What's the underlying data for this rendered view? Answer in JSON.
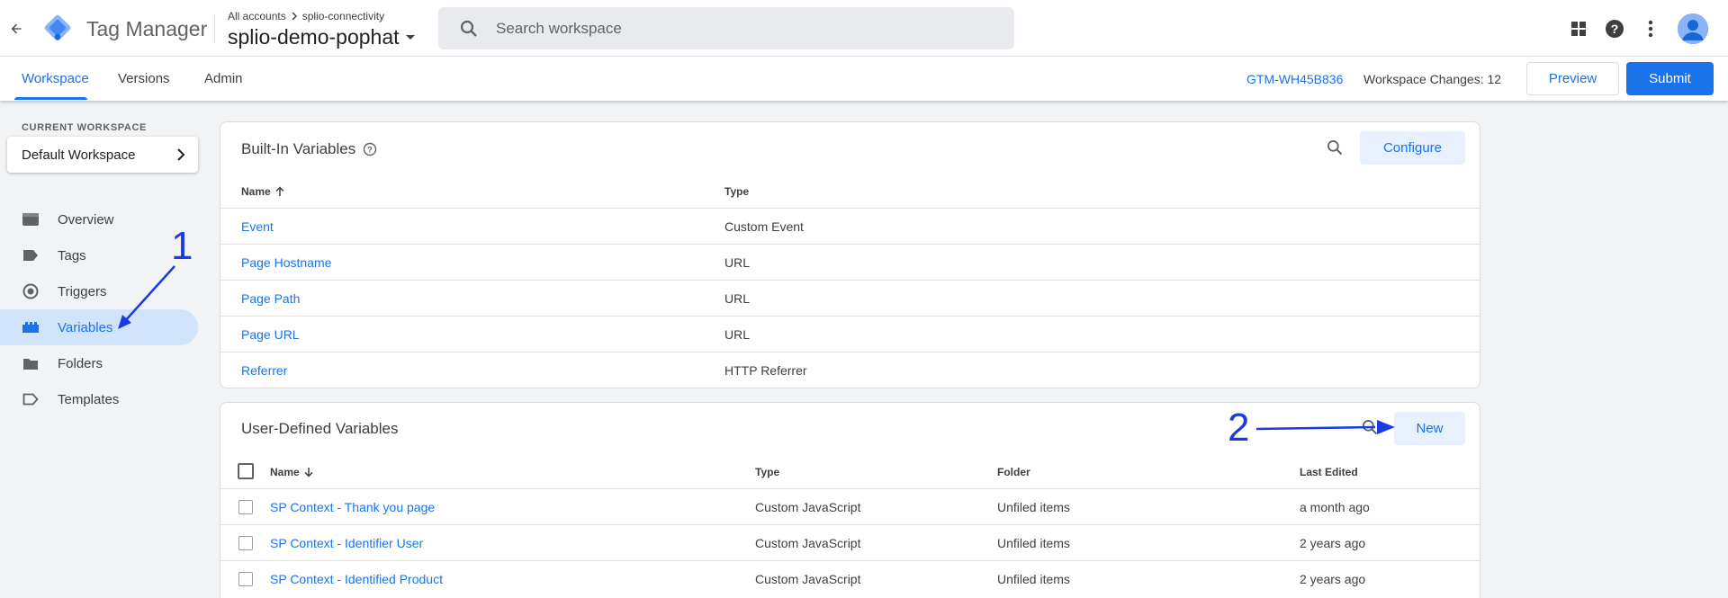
{
  "header": {
    "brand": "Tag Manager",
    "breadcrumb_account": "All accounts",
    "breadcrumb_container": "splio-connectivity",
    "container_name": "splio-demo-pophat",
    "search_placeholder": "Search workspace"
  },
  "subnav": {
    "tabs": [
      {
        "label": "Workspace",
        "active": true
      },
      {
        "label": "Versions",
        "active": false
      },
      {
        "label": "Admin",
        "active": false
      }
    ],
    "container_id": "GTM-WH45B836",
    "workspace_changes": "Workspace Changes: 12",
    "preview_label": "Preview",
    "submit_label": "Submit"
  },
  "sidebar": {
    "current_workspace_label": "CURRENT WORKSPACE",
    "workspace_name": "Default Workspace",
    "items": [
      {
        "label": "Overview",
        "icon": "overview-icon",
        "active": false
      },
      {
        "label": "Tags",
        "icon": "tag-icon",
        "active": false
      },
      {
        "label": "Triggers",
        "icon": "trigger-icon",
        "active": false
      },
      {
        "label": "Variables",
        "icon": "variables-icon",
        "active": true
      },
      {
        "label": "Folders",
        "icon": "folder-icon",
        "active": false
      },
      {
        "label": "Templates",
        "icon": "template-icon",
        "active": false
      }
    ]
  },
  "builtin": {
    "title": "Built-In Variables",
    "configure_label": "Configure",
    "col_name": "Name",
    "col_type": "Type",
    "rows": [
      {
        "name": "Event",
        "type": "Custom Event"
      },
      {
        "name": "Page Hostname",
        "type": "URL"
      },
      {
        "name": "Page Path",
        "type": "URL"
      },
      {
        "name": "Page URL",
        "type": "URL"
      },
      {
        "name": "Referrer",
        "type": "HTTP Referrer"
      }
    ]
  },
  "userdefined": {
    "title": "User-Defined Variables",
    "new_label": "New",
    "col_name": "Name",
    "col_type": "Type",
    "col_folder": "Folder",
    "col_last_edited": "Last Edited",
    "rows": [
      {
        "name": "SP Context - Thank you page",
        "type": "Custom JavaScript",
        "folder": "Unfiled items",
        "last_edited": "a month ago"
      },
      {
        "name": "SP Context - Identifier User",
        "type": "Custom JavaScript",
        "folder": "Unfiled items",
        "last_edited": "2 years ago"
      },
      {
        "name": "SP Context - Identified Product",
        "type": "Custom JavaScript",
        "folder": "Unfiled items",
        "last_edited": "2 years ago"
      }
    ]
  },
  "annotations": {
    "step1": "1",
    "step2": "2",
    "color": "#1a3ae8"
  },
  "colors": {
    "accent": "#1a73e8",
    "active_nav_bg": "#d2e3fc",
    "page_bg": "#f1f3f4"
  }
}
